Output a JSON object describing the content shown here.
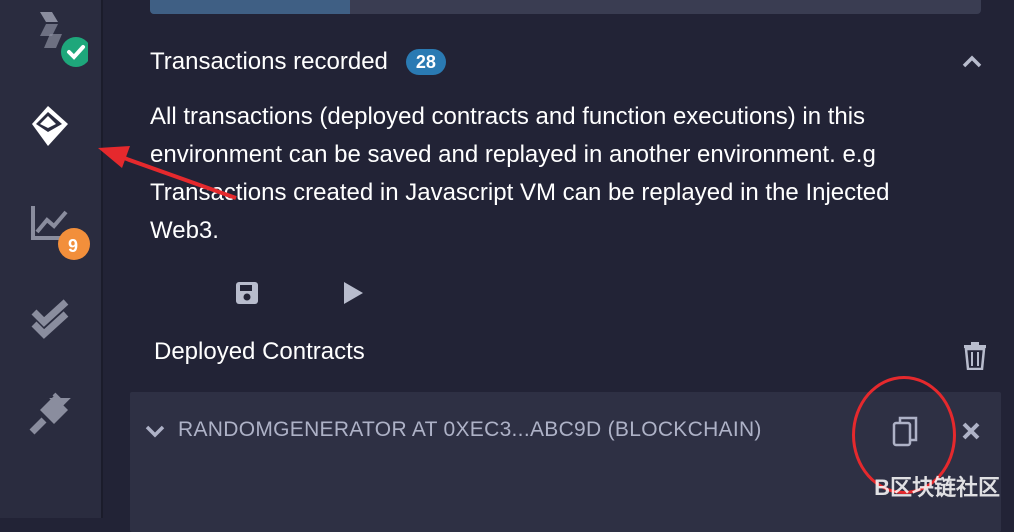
{
  "sidebar": {
    "items": [
      {
        "name": "solidity-compiler",
        "icon": "compile-icon",
        "status": "success"
      },
      {
        "name": "deploy-run",
        "icon": "ethereum-icon",
        "active": true
      },
      {
        "name": "analysis",
        "icon": "chart-icon",
        "badge": "9"
      },
      {
        "name": "testing",
        "icon": "double-check-icon"
      },
      {
        "name": "plugin-manager",
        "icon": "plug-icon"
      }
    ]
  },
  "transactions": {
    "title": "Transactions recorded",
    "count": "28",
    "description": "All transactions (deployed contracts and function executions) in this environment can be saved and replayed in another environment. e.g Transactions created in Javascript VM can be replayed in the Injected Web3."
  },
  "deployed": {
    "title": "Deployed Contracts",
    "contract_label": "RANDOMGENERATOR AT 0XEC3...ABC9D (BLOCKCHAIN)"
  },
  "watermark": {
    "text": "B区块链社区"
  },
  "colors": {
    "accent_blue": "#2a7ab3",
    "badge_orange": "#f28f3b",
    "success_green": "#1ea77b",
    "annotation_red": "#e5292d"
  }
}
